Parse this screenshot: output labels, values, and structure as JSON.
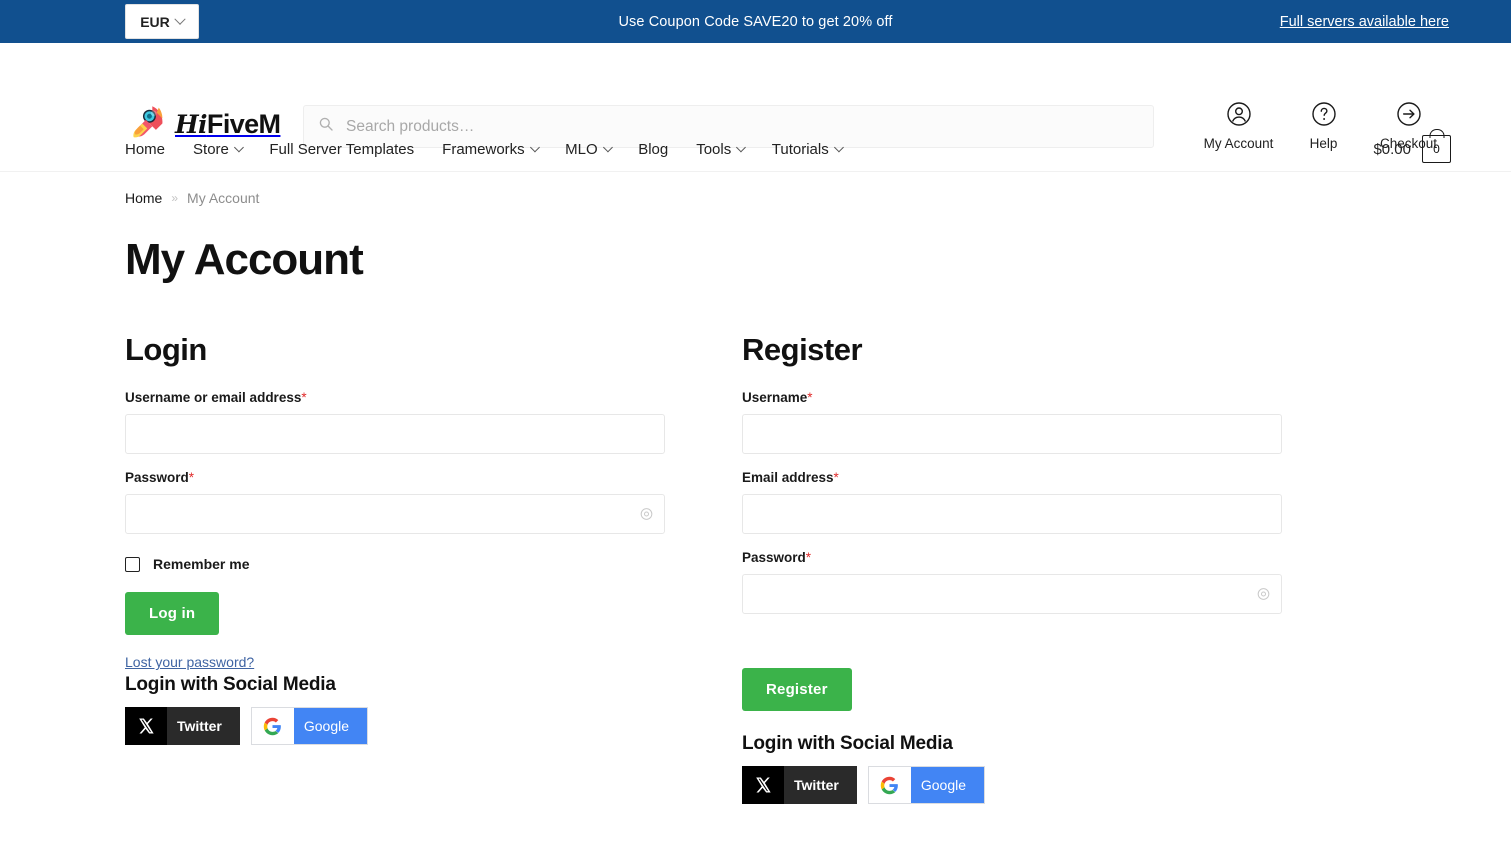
{
  "topbar": {
    "currency": "EUR",
    "currency_icon": "chevron-down-icon",
    "promo": "Use Coupon Code SAVE20 to get 20% off",
    "right_link": "Full servers available here",
    "bg_color": "#11508F"
  },
  "header": {
    "logo_hi": "Hi",
    "logo_rest": "FiveM",
    "logo_icon": "rocket-icon",
    "search": {
      "placeholder": "Search products…",
      "value": "",
      "icon": "search-icon"
    },
    "actions": [
      {
        "label": "My Account",
        "icon": "user-circle-icon"
      },
      {
        "label": "Help",
        "icon": "question-circle-icon"
      },
      {
        "label": "Checkout",
        "icon": "arrow-right-circle-icon"
      }
    ]
  },
  "nav": {
    "items": [
      {
        "label": "Home",
        "has_dropdown": false
      },
      {
        "label": "Store",
        "has_dropdown": true
      },
      {
        "label": "Full Server Templates",
        "has_dropdown": false
      },
      {
        "label": "Frameworks",
        "has_dropdown": true
      },
      {
        "label": "MLO",
        "has_dropdown": true
      },
      {
        "label": "Blog",
        "has_dropdown": false
      },
      {
        "label": "Tools",
        "has_dropdown": true
      },
      {
        "label": "Tutorials",
        "has_dropdown": true
      }
    ],
    "cart": {
      "total": "$0.00",
      "count": "0",
      "icon": "shopping-bag-icon"
    }
  },
  "breadcrumb": {
    "home": "Home",
    "separator": "»",
    "current": "My Account"
  },
  "page_title": "My Account",
  "login": {
    "heading": "Login",
    "username": {
      "label": "Username or email address",
      "required": "*",
      "value": ""
    },
    "password": {
      "label": "Password",
      "required": "*",
      "value": "",
      "toggle_icon": "eye-icon"
    },
    "remember": "Remember me",
    "submit": "Log in",
    "lost_password": "Lost your password?",
    "social_heading": "Login with Social Media",
    "social": [
      {
        "name": "Twitter",
        "icon": "x-twitter-icon",
        "color": "#2a2a2a"
      },
      {
        "name": "Google",
        "icon": "google-icon",
        "color": "#4285F4"
      }
    ]
  },
  "register": {
    "heading": "Register",
    "username": {
      "label": "Username",
      "required": "*",
      "value": ""
    },
    "email": {
      "label": "Email address",
      "required": "*",
      "value": ""
    },
    "password": {
      "label": "Password",
      "required": "*",
      "value": "",
      "toggle_icon": "eye-icon"
    },
    "submit": "Register",
    "social_heading": "Login with Social Media",
    "social": [
      {
        "name": "Twitter",
        "icon": "x-twitter-icon",
        "color": "#2a2a2a"
      },
      {
        "name": "Google",
        "icon": "google-icon",
        "color": "#4285F4"
      }
    ]
  },
  "theme": {
    "accent_green": "#3BB34A",
    "brand_blue": "#11508F",
    "required_red": "#e02b2b"
  }
}
